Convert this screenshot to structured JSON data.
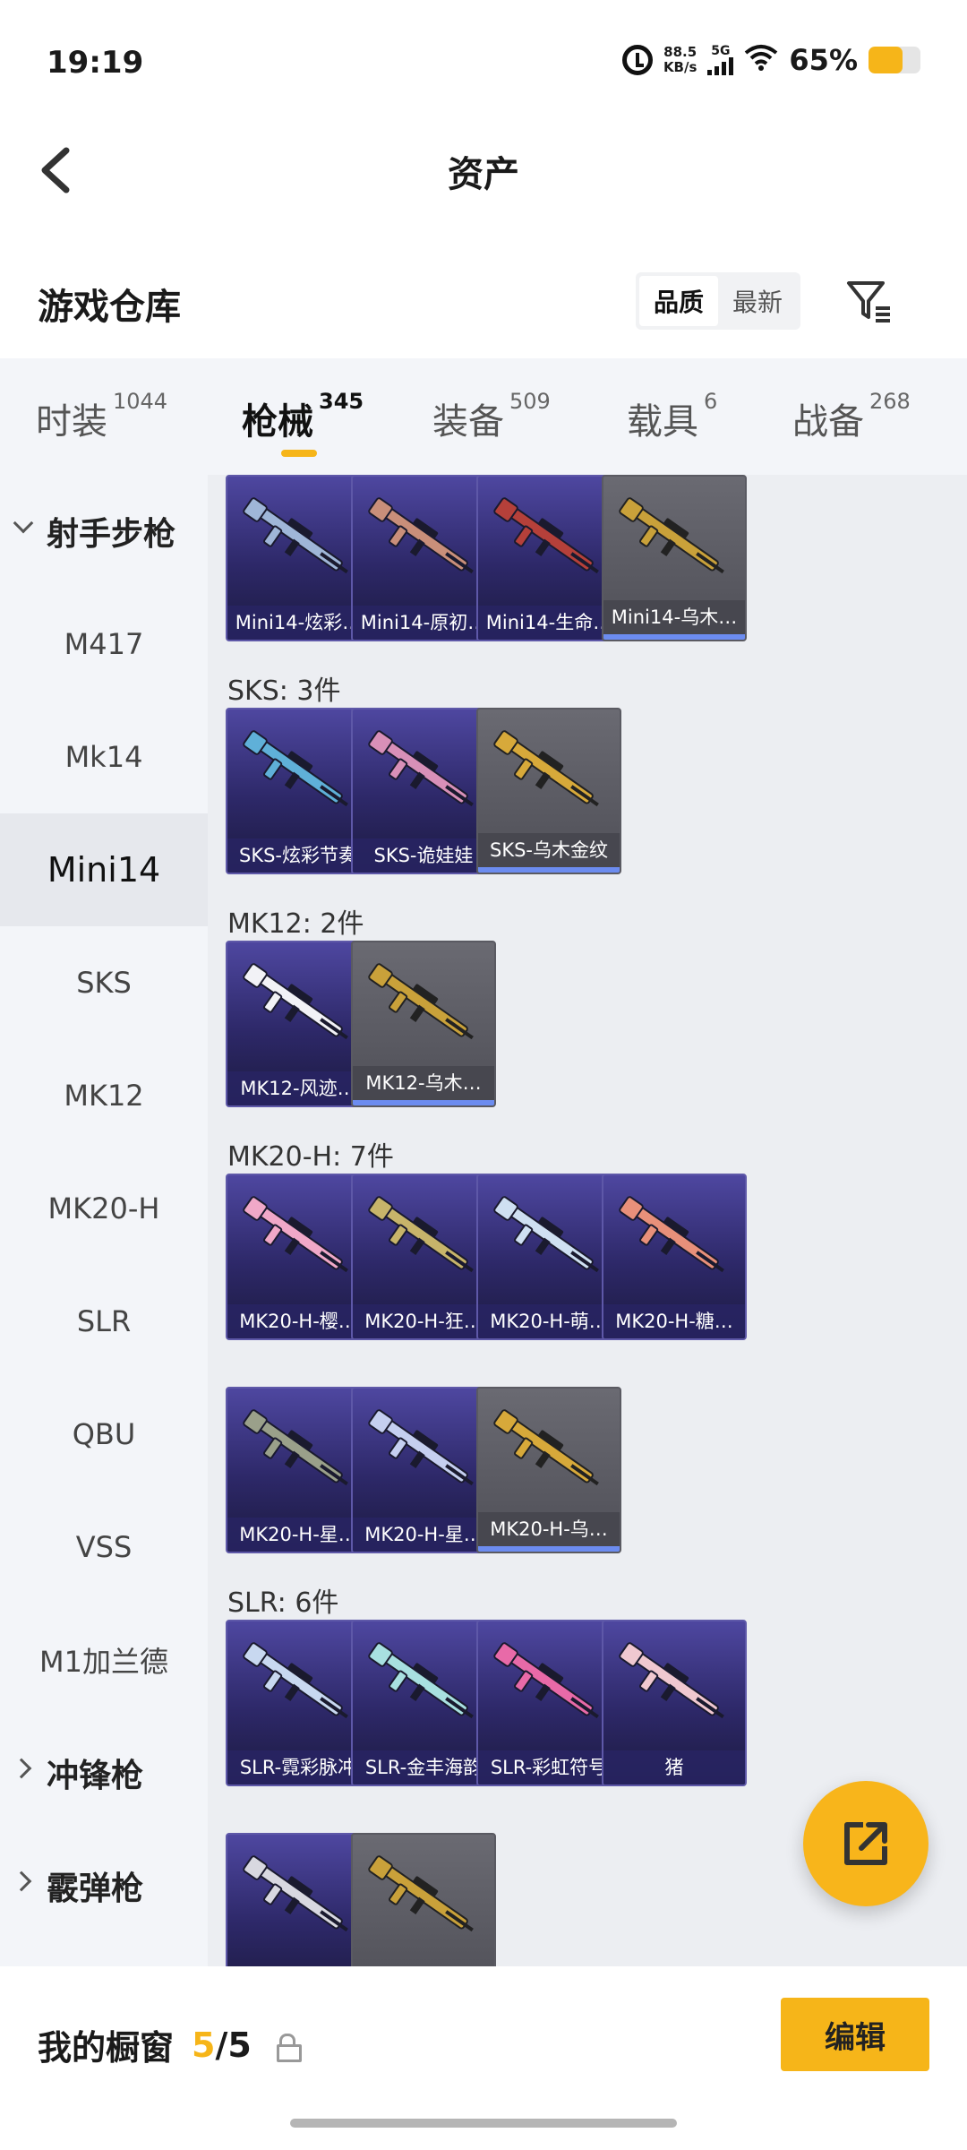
{
  "status_bar": {
    "time": "19:19",
    "speed_value": "88.5",
    "speed_unit": "KB/s",
    "network": "5G",
    "battery_percent": "65%",
    "battery_level": 0.65
  },
  "header": {
    "title": "资产"
  },
  "section": {
    "title": "游戏仓库",
    "sort_options": [
      "品质",
      "最新"
    ],
    "sort_selected": "品质"
  },
  "tabs": [
    {
      "label": "时装",
      "count": "1044"
    },
    {
      "label": "枪械",
      "count": "345",
      "selected": true
    },
    {
      "label": "装备",
      "count": "509"
    },
    {
      "label": "载具",
      "count": "6"
    },
    {
      "label": "战备",
      "count": "268"
    }
  ],
  "sidebar": {
    "group_expanded": "射手步枪",
    "items": [
      "M417",
      "Mk14",
      "Mini14",
      "SKS",
      "MK12",
      "MK20-H",
      "SLR",
      "QBU",
      "VSS",
      "M1加兰德"
    ],
    "selected": "Mini14",
    "groups_collapsed": [
      "冲锋枪",
      "霰弹枪"
    ]
  },
  "groups": [
    {
      "label": "",
      "items": [
        {
          "name": "Mini14-炫彩…",
          "tone": "purple",
          "color": "#9fb6d8"
        },
        {
          "name": "Mini14-原初…",
          "tone": "purple",
          "color": "#c98f7a"
        },
        {
          "name": "Mini14-生命…",
          "tone": "purple",
          "color": "#b5403a"
        },
        {
          "name": "Mini14-乌木…",
          "tone": "gray",
          "color": "#c9a13a"
        }
      ]
    },
    {
      "label": "SKS: 3件",
      "items": [
        {
          "name": "SKS-炫彩节奏",
          "tone": "purple",
          "color": "#5fb0d8"
        },
        {
          "name": "SKS-诡娃娃",
          "tone": "purple",
          "color": "#d890b8"
        },
        {
          "name": "SKS-乌木金纹",
          "tone": "gray",
          "color": "#d7a93a"
        }
      ]
    },
    {
      "label": "MK12: 2件",
      "items": [
        {
          "name": "MK12-风迹…",
          "tone": "purple",
          "color": "#f2f2f6"
        },
        {
          "name": "MK12-乌木…",
          "tone": "gray",
          "color": "#c9a13a"
        }
      ]
    },
    {
      "label": "MK20-H: 7件",
      "items": [
        {
          "name": "MK20-H-樱…",
          "tone": "purple",
          "color": "#f0a8c8"
        },
        {
          "name": "MK20-H-狂…",
          "tone": "purple",
          "color": "#c7b46a"
        },
        {
          "name": "MK20-H-萌…",
          "tone": "purple",
          "color": "#cfe0f2"
        },
        {
          "name": "MK20-H-糖…",
          "tone": "purple",
          "color": "#e8907a"
        },
        {
          "name": "MK20-H-星…",
          "tone": "purple",
          "color": "#9aa08a"
        },
        {
          "name": "MK20-H-星…",
          "tone": "purple",
          "color": "#c5cff0"
        },
        {
          "name": "MK20-H-乌…",
          "tone": "gray",
          "color": "#d7a93a"
        }
      ]
    },
    {
      "label": "SLR: 6件",
      "items": [
        {
          "name": "SLR-霓彩脉冲",
          "tone": "purple",
          "color": "#c8d8f0"
        },
        {
          "name": "SLR-金丰海韵",
          "tone": "purple",
          "color": "#a8e0e0"
        },
        {
          "name": "SLR-彩虹符号",
          "tone": "purple",
          "color": "#e86aa8"
        },
        {
          "name": "猪",
          "tone": "purple",
          "color": "#f0c8d0"
        },
        {
          "name": "",
          "tone": "purple",
          "color": "#d8d8e0"
        },
        {
          "name": "",
          "tone": "gray",
          "color": "#c9a13a"
        }
      ]
    }
  ],
  "bottom": {
    "showcase_label": "我的橱窗",
    "count_current": "5",
    "count_total": "/5",
    "edit_label": "编辑"
  }
}
